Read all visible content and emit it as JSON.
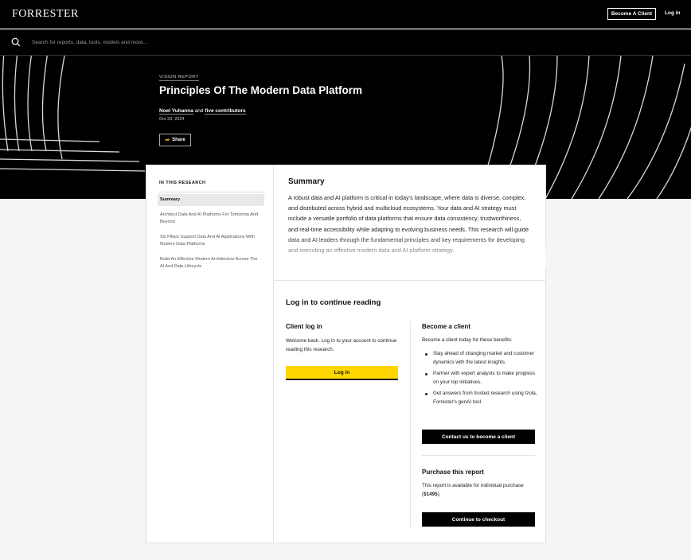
{
  "header": {
    "logo": "FORRESTER",
    "become_client": "Become A Client",
    "login": "Log in"
  },
  "search": {
    "placeholder": "Search for reports, data, tools, models and more..."
  },
  "report": {
    "type": "VISION REPORT",
    "title": "Principles Of The Modern Data Platform",
    "author": "Noel Yuhanna",
    "and": "and",
    "contributors": "five contributors",
    "date": "Oct 29, 2024",
    "share": "Share"
  },
  "toc": {
    "heading": "IN THIS RESEARCH",
    "items": [
      "Summary",
      "Architect Data And AI Platforms For Tomorrow And Beyond",
      "Six Pillars Support Data And AI Applications With Modern Data Platforms",
      "Build An Effective Modern Architecture Across The AI And Data Lifecycle"
    ]
  },
  "summary": {
    "title": "Summary",
    "body": "A robust data and AI platform is critical in today's landscape, where data is diverse, complex, and distributed across hybrid and multicloud ecosystems. Your data and AI strategy must include a versatile portfolio of data platforms that ensure data consistency, trustworthiness, and real-time accessibility while adapting to evolving business needs. This research will guide data and AI leaders through the fundamental principles and key requirements for developing and executing an effective modern data and AI platform strategy."
  },
  "login_section": {
    "title": "Log in to continue reading",
    "client_title": "Client log in",
    "client_text": "Welcome back. Log in to your account to continue reading this research.",
    "login_button": "Log in"
  },
  "become_section": {
    "title": "Become a client",
    "intro": "Become a client today for these benefits:",
    "benefits": [
      "Stay ahead of changing market and customer dynamics with the latest insights.",
      "Partner with expert analysts to make progress on your top initiatives.",
      "Get answers from trusted research using Izola, Forrester's genAI tool."
    ],
    "contact_button": "Contact us to become a client"
  },
  "purchase_section": {
    "title": "Purchase this report",
    "text_pre": "This report is available for individual purchase (",
    "price": "$1495",
    "text_post": ").",
    "checkout_button": "Continue to checkout"
  },
  "colors": {
    "accent_yellow": "#ffd600",
    "black": "#000000"
  }
}
